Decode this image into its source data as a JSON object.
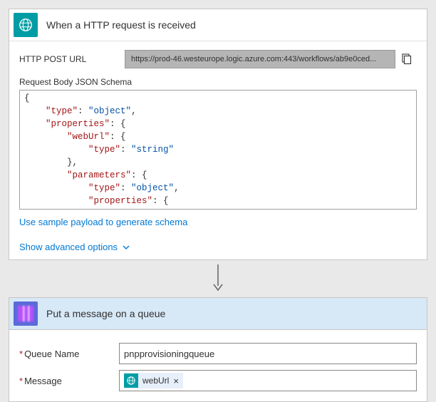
{
  "httpCard": {
    "title": "When a HTTP request is received",
    "urlLabel": "HTTP POST URL",
    "urlValue": "https://prod-46.westeurope.logic.azure.com:443/workflows/ab9e0ced...",
    "schemaLabel": "Request Body JSON Schema",
    "schema": {
      "l0": "{",
      "k1": "\"type\"",
      "v1": "\"object\"",
      "k2": "\"properties\"",
      "k3": "\"webUrl\"",
      "k4": "\"type\"",
      "v4": "\"string\"",
      "k5": "\"parameters\"",
      "k6": "\"type\"",
      "v6": "\"object\"",
      "k7": "\"properties\""
    },
    "samplePayloadLink": "Use sample payload to generate schema",
    "advancedLink": "Show advanced options"
  },
  "queueCard": {
    "title": "Put a message on a queue",
    "queueNameLabel": "Queue Name",
    "queueNameValue": "pnpprovisioningqueue",
    "messageLabel": "Message",
    "messageToken": "webUrl",
    "messageTokenX": "×"
  }
}
